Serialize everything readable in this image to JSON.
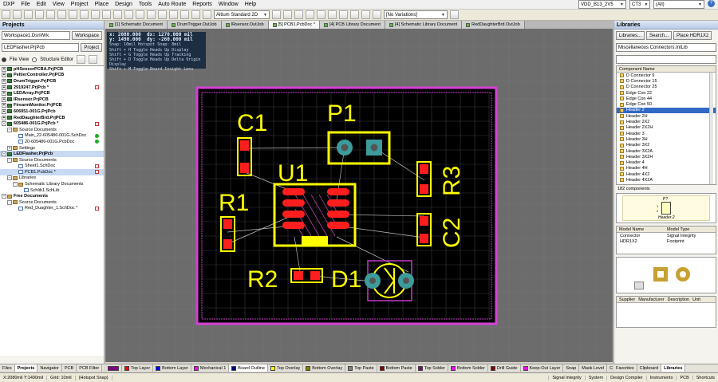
{
  "menubar": {
    "items": [
      "DXP",
      "File",
      "Edit",
      "View",
      "Project",
      "Place",
      "Design",
      "Tools",
      "Auto Route",
      "Reports",
      "Window",
      "Help"
    ],
    "right_label": "VDD_B13_2V5",
    "right_dropdown": "CT3",
    "right_filter": "(All)"
  },
  "toolbar": {
    "layer_stack": "Altium Standard 2D",
    "variation": "[No Variations]"
  },
  "projects_panel": {
    "title": "Projects",
    "workspace_field": "Workspace1.DsnWrk",
    "workspace_button": "Workspace",
    "project_field": "LEDFlasher.PrjPcb",
    "project_button": "Project",
    "view_file": "File View",
    "view_structure": "Structure Editor",
    "tree": [
      {
        "label": "pHSensorPCBA.PrjPCB",
        "depth": 0,
        "bold": true,
        "kind": "proj",
        "exp": "+",
        "mark": ""
      },
      {
        "label": "PeltierController.PrjPCB",
        "depth": 0,
        "bold": true,
        "kind": "proj",
        "exp": "+",
        "mark": ""
      },
      {
        "label": "DrumTrigger.PrjPCB",
        "depth": 0,
        "bold": true,
        "kind": "proj",
        "exp": "+",
        "mark": ""
      },
      {
        "label": "2919247.PrjPcb *",
        "depth": 0,
        "bold": true,
        "kind": "proj",
        "exp": "+",
        "mark": "doc"
      },
      {
        "label": "LEDArray.PrjPCB",
        "depth": 0,
        "bold": true,
        "kind": "proj",
        "exp": "+",
        "mark": ""
      },
      {
        "label": "IRsensor.PrjPCB",
        "depth": 0,
        "bold": true,
        "kind": "proj",
        "exp": "+",
        "mark": ""
      },
      {
        "label": "FirearmMonitor.PrjPCB",
        "depth": 0,
        "bold": true,
        "kind": "proj",
        "exp": "+",
        "mark": ""
      },
      {
        "label": "606951-001G.PrjPcb",
        "depth": 0,
        "bold": true,
        "kind": "proj",
        "exp": "+",
        "mark": ""
      },
      {
        "label": "RedDaughterBrd.PrjPCB",
        "depth": 0,
        "bold": true,
        "kind": "proj",
        "exp": "+",
        "mark": ""
      },
      {
        "label": "605486-001G.PrjPcb *",
        "depth": 0,
        "bold": true,
        "kind": "proj",
        "exp": "-",
        "mark": "doc"
      },
      {
        "label": "Source Documents",
        "depth": 1,
        "bold": false,
        "kind": "folder",
        "exp": "-",
        "mark": ""
      },
      {
        "label": "Main_22-605486-001G.SchDoc",
        "depth": 2,
        "bold": false,
        "kind": "doc",
        "exp": "",
        "mark": "green"
      },
      {
        "label": "20-605486-001G.PcbDoc",
        "depth": 2,
        "bold": false,
        "kind": "doc",
        "exp": "",
        "mark": "green"
      },
      {
        "label": "Settings",
        "depth": 1,
        "bold": false,
        "kind": "folder",
        "exp": "+",
        "mark": ""
      },
      {
        "label": "LEDFlasher.PrjPcb",
        "depth": 0,
        "bold": true,
        "kind": "proj",
        "exp": "-",
        "mark": "",
        "selected": true
      },
      {
        "label": "Source Documents",
        "depth": 1,
        "bold": false,
        "kind": "folder",
        "exp": "-",
        "mark": ""
      },
      {
        "label": "Sheet1.SchDoc",
        "depth": 2,
        "bold": false,
        "kind": "doc",
        "exp": "",
        "mark": "doc"
      },
      {
        "label": "PCB1.PcbDoc *",
        "depth": 2,
        "bold": false,
        "kind": "doc",
        "exp": "",
        "mark": "doc",
        "selected": true
      },
      {
        "label": "Libraries",
        "depth": 1,
        "bold": false,
        "kind": "folder",
        "exp": "-",
        "mark": ""
      },
      {
        "label": "Schematic Library Documents",
        "depth": 2,
        "bold": false,
        "kind": "folder",
        "exp": "-",
        "mark": ""
      },
      {
        "label": "Schlib1.SchLib",
        "depth": 3,
        "bold": false,
        "kind": "doc",
        "exp": "",
        "mark": ""
      },
      {
        "label": "Free Documents",
        "depth": 0,
        "bold": true,
        "kind": "folder",
        "exp": "-",
        "mark": ""
      },
      {
        "label": "Source Documents",
        "depth": 1,
        "bold": false,
        "kind": "folder",
        "exp": "-",
        "mark": ""
      },
      {
        "label": "Red_Duaghter_1.SchDoc *",
        "depth": 2,
        "bold": false,
        "kind": "doc",
        "exp": "",
        "mark": "doc"
      }
    ],
    "bottom_tabs": [
      "Files",
      "Projects",
      "Navigator",
      "PCB",
      "PCB Filter"
    ]
  },
  "doc_tabs": [
    "[1] Schematic Document",
    "DrumTrigger.OutJob",
    "IRsensor.OutJob",
    "[5] PCB1.PcbDoc *",
    "[4] PCB Library Document",
    "[4] Schematic Library Document",
    "RedDaughterBrd.OutJob"
  ],
  "hud": {
    "x_label": "x: 2080.000",
    "dx_label": "dx: 1270.000 mil",
    "y_label": "y: 1490.000",
    "dy_label": "dy: -260.000 mil",
    "snap": "Snap: 10mil Hotspot Snap: 8mil",
    "lines": [
      "Shift + H  Toggle Heads Up Display",
      "Shift + G  Toggle Heads Up Tracking",
      "Shift + D  Toggle Heads Up Delta Origin Display",
      "Shift + M  Toggle Board Insight Lens"
    ]
  },
  "pcb": {
    "designators": {
      "c1": "C1",
      "p1": "P1",
      "u1": "U1",
      "r3": "R3",
      "r1": "R1",
      "c2": "C2",
      "r2": "R2",
      "d1": "D1"
    },
    "colors": {
      "board": "#000000",
      "outline": "#d640d6",
      "silk": "#ffff00",
      "pad_smd": "#ff1e1e",
      "pad_th": "#3c9c9c",
      "grid": "#3a3a3a",
      "ratsnest": "#bfbfbf",
      "keepout": "#c43ac4"
    }
  },
  "layer_tabs": [
    {
      "name": "Top Layer",
      "color": "#ff0000"
    },
    {
      "name": "Bottom Layer",
      "color": "#0000ff"
    },
    {
      "name": "Mechanical 1",
      "color": "#ff00ff"
    },
    {
      "name": "Board Outline",
      "color": "#000080",
      "active": true
    },
    {
      "name": "Top Overlay",
      "color": "#ffff00"
    },
    {
      "name": "Bottom Overlay",
      "color": "#808000"
    },
    {
      "name": "Top Paste",
      "color": "#808080"
    },
    {
      "name": "Bottom Paste",
      "color": "#800000"
    },
    {
      "name": "Top Solder",
      "color": "#800080"
    },
    {
      "name": "Bottom Solder",
      "color": "#ff00ff"
    },
    {
      "name": "Drill Guide",
      "color": "#800000"
    },
    {
      "name": "Keep-Out Layer",
      "color": "#ff00ff"
    },
    {
      "name": "Snap",
      "color": ""
    },
    {
      "name": "Mask Level",
      "color": ""
    },
    {
      "name": "Clear",
      "color": ""
    }
  ],
  "libraries_panel": {
    "title": "Libraries",
    "btn_libraries": "Libraries...",
    "btn_search": "Search...",
    "btn_place": "Place HDR1X2",
    "library": "Miscellaneous Connectors.IntLib",
    "filter": "",
    "list_header": "Component Name",
    "components": [
      "D Connector 9",
      "D Connector 15",
      "D Connector 25",
      "Edge Con 22",
      "Edge Con 44",
      "Edge Con 50",
      "Header 2",
      "Header 2H",
      "Header 2X2",
      "Header 2X2H",
      "Header 3",
      "Header 3H",
      "Header 3X2",
      "Header 3X2A",
      "Header 3X2H",
      "Header 4",
      "Header 4H",
      "Header 4X2",
      "Header 4X2A"
    ],
    "selected_component": "Header 2",
    "count": "182 components",
    "preview_designator": "P?",
    "preview_name": "Header 2",
    "preview_pins": [
      "1",
      "2"
    ],
    "model_headers": [
      "Model Name",
      "Model Type"
    ],
    "models": [
      [
        "Connector",
        "Signal Integrity"
      ],
      [
        "HDR1X2",
        "Footprint"
      ]
    ],
    "supplier_headers": [
      "Supplier",
      "Manufacturer",
      "Description",
      "Unit"
    ],
    "bottom_tabs": [
      "Favorites",
      "Clipboard",
      "Libraries"
    ]
  },
  "statusbar": {
    "coords": "X:2080mil Y:1490mil",
    "grid": "Grid: 10mil",
    "snap": "(Hotspot Snap)",
    "right": [
      "Signal Integrity",
      "System",
      "Design Compiler",
      "Instruments",
      "PCB",
      "Shortcuts"
    ]
  }
}
